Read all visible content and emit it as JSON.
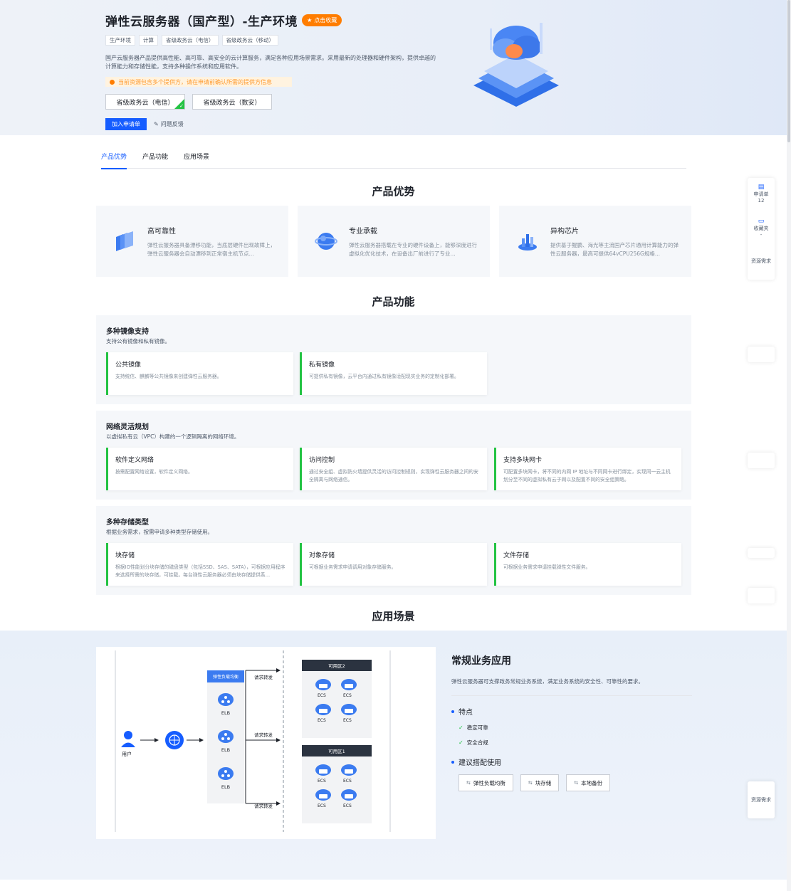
{
  "header": {
    "title": "弹性云服务器（国产型）-生产环境",
    "favorite_label": "点击收藏",
    "tags": [
      "生产环境",
      "计算",
      "省级政务云（电信）",
      "省级政务云（移动）"
    ],
    "description": "国产云服务器产品提供高性能、高可靠、高安全的云计算服务，满足各种应用场景需求。采用最新的处理器和硬件架构，提供卓越的计算能力和存储性能，支持多种操作系统和应用软件。",
    "notice": "当前资源包含多个提供方，请在申请前确认所需的提供方信息",
    "providers": [
      "省级政务云（电信）",
      "省级政务云（数安）"
    ],
    "apply_label": "加入申请单",
    "feedback_label": "问题反馈"
  },
  "tabs": [
    "产品优势",
    "产品功能",
    "应用场景"
  ],
  "advantages": {
    "title": "产品优势",
    "items": [
      {
        "title": "高可靠性",
        "desc": "弹性云服务器具备漂移功能，当底层硬件出现故障上，弹性云服务器会自动漂移到正常宿主机节点..."
      },
      {
        "title": "专业承载",
        "desc": "弹性云服务器搭载在专业的硬件设备上，能够深度进行虚拟化优化技术，在设备出厂前进行了专业..."
      },
      {
        "title": "异构芯片",
        "desc": "提供基于鲲鹏、海光等主流国产芯片通用计算能力的弹性云服务器，最高可提供64vCPU256G规格..."
      }
    ]
  },
  "functions": {
    "title": "产品功能",
    "groups": [
      {
        "title": "多种镜像支持",
        "subtitle": "支持公有镜像和私有镜像。",
        "cards": [
          {
            "title": "公共镜像",
            "desc": "支持统信、麒麟等公共镜像来创建弹性云服务器。"
          },
          {
            "title": "私有镜像",
            "desc": "可提供私有镜像，云平台内通过私有镜像适配现实业务的定制化部署。"
          }
        ]
      },
      {
        "title": "网络灵活规划",
        "subtitle": "以虚拟私有云（VPC）构建的一个逻辑隔离的网络环境。",
        "cards": [
          {
            "title": "软件定义网络",
            "desc": "按需配置网络设置，软件定义网络。"
          },
          {
            "title": "访问控制",
            "desc": "通过安全组、虚拟防火墙提供灵活的访问控制规则，实现弹性云服务器之间的安全隔离与网络通信。"
          },
          {
            "title": "支持多块网卡",
            "desc": "可配置多块网卡，将不同的内网 IP 地址与不同网卡进行绑定，实现同一云主机划分至不同的虚拟私有云子网以及配置不同的安全组策略。"
          }
        ]
      },
      {
        "title": "多种存储类型",
        "subtitle": "根据业务需求，按需申请多种类型存储使用。",
        "cards": [
          {
            "title": "块存储",
            "desc": "根据IO性能划分块存储的磁盘类型（包括SSD、SAS、SATA），可根据应用程序来选择所需的块存储，可挂载。每台弹性云服务器必须由块存储提供系..."
          },
          {
            "title": "对象存储",
            "desc": "可根据业务需求申请调用对象存储服务。"
          },
          {
            "title": "文件存储",
            "desc": "可根据业务需求申请挂载弹性文件服务。"
          }
        ]
      }
    ]
  },
  "scenarios": {
    "title": "应用场景",
    "item": {
      "title": "常规业务应用",
      "desc": "弹性云服务器可支撑政务常规业务系统，满足业务系统的安全性、可靠性的要求。",
      "features_label": "特点",
      "features": [
        "稳定可靠",
        "安全合规"
      ],
      "recommend_label": "建议搭配使用",
      "recommend": [
        "弹性负载均衡",
        "块存储",
        "本地备份"
      ]
    },
    "diagram": {
      "user_label": "用户",
      "lb_title": "弹性负载均衡",
      "elb_label": "ELB",
      "forward_label": "请求转发",
      "zone2": "可用区2",
      "zone1": "可用区1",
      "ecs_label": "ECS"
    }
  },
  "float_panel": {
    "apply_list": "申请单",
    "apply_count": "12",
    "favorites": "收藏夹",
    "favorites_count": "-",
    "resource_request": "资源需求"
  },
  "colors": {
    "primary": "#165dff",
    "success": "#23c343",
    "warning": "#ff7d00"
  }
}
